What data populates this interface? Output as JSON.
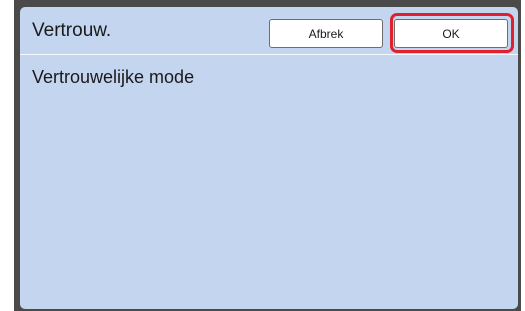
{
  "header": {
    "title": "Vertrouw.",
    "cancel_label": "Afbrek",
    "ok_label": "OK"
  },
  "body": {
    "mode_label": "Vertrouwelijke mode"
  },
  "colors": {
    "panel_background": "#c3d5ef",
    "frame": "#4a4a4a",
    "highlight": "#e0202c"
  }
}
